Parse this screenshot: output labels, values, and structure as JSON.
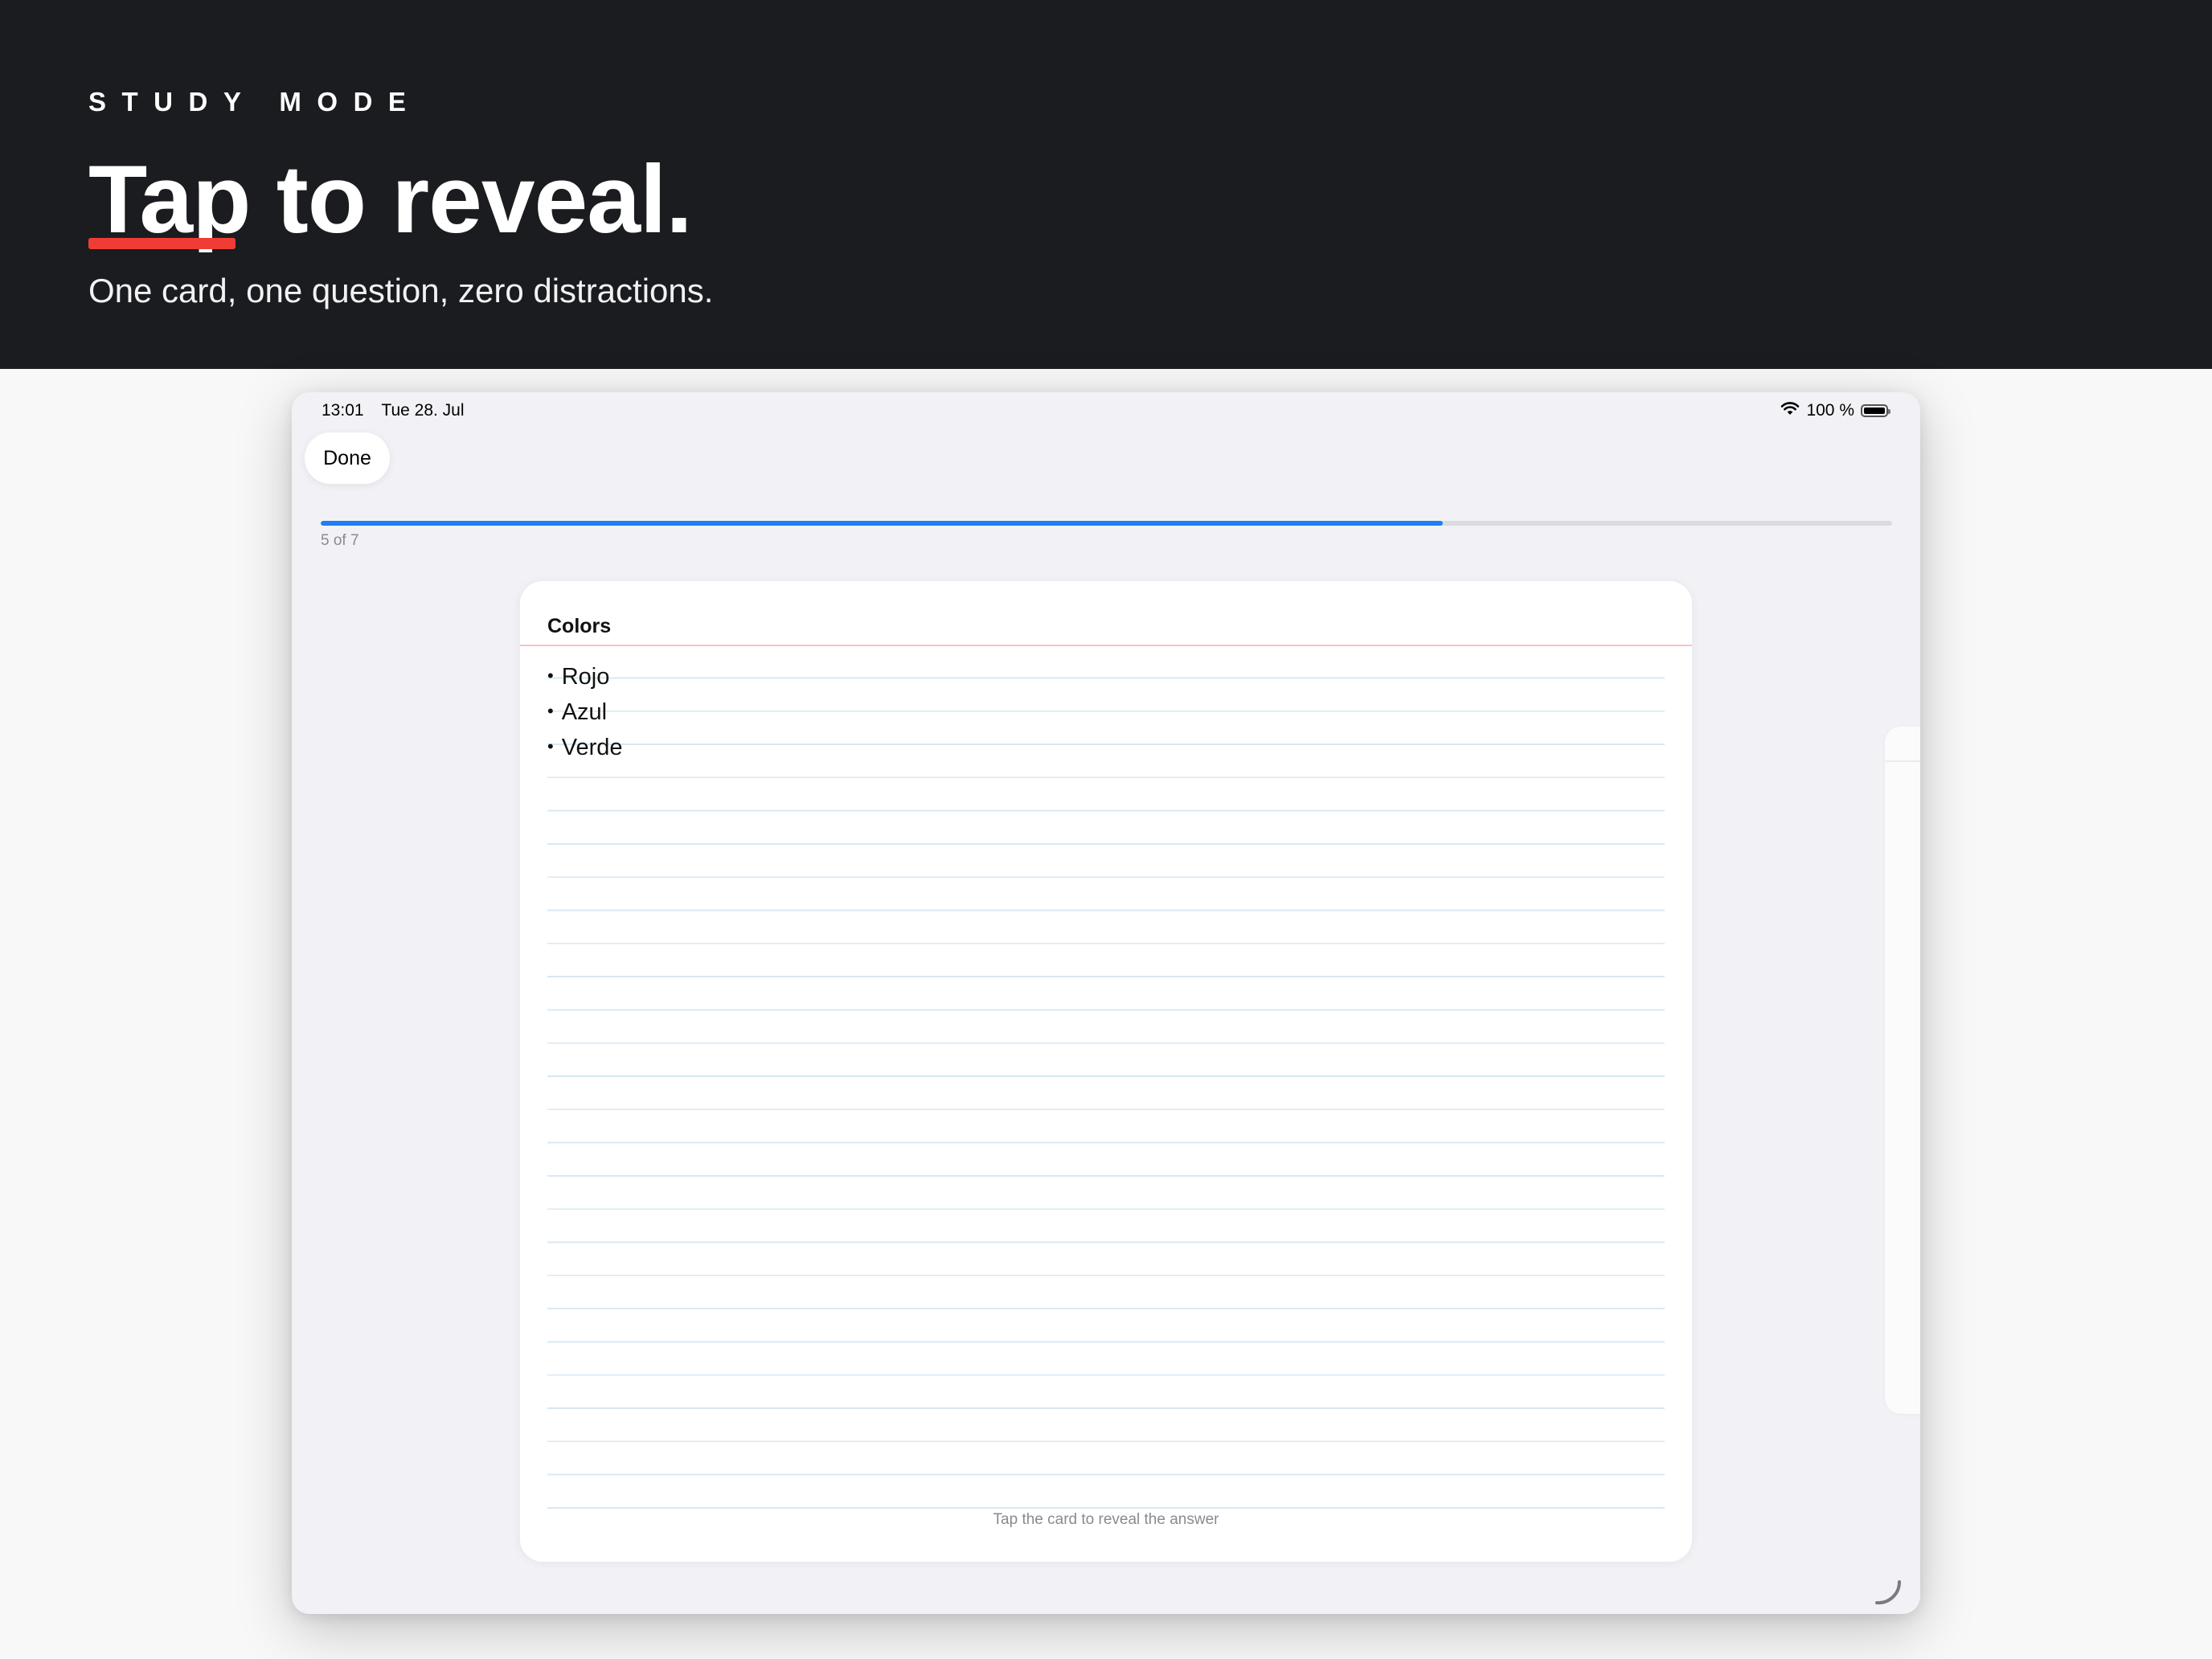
{
  "hero": {
    "eyebrow": "STUDY MODE",
    "headline_emphasis": "Tap",
    "headline_rest": " to reveal.",
    "subline": "One card, one question, zero distractions.",
    "accent_color": "#ef3d35"
  },
  "status_bar": {
    "time": "13:01",
    "date": "Tue 28. Jul",
    "battery": "100 %",
    "icons": [
      "wifi-icon",
      "battery-icon"
    ]
  },
  "toolbar": {
    "done_label": "Done"
  },
  "progress": {
    "current": 5,
    "total": 7,
    "fraction": 0.714,
    "label": "5 of 7",
    "color": "#1d7ff2"
  },
  "card": {
    "title": "Colors",
    "items": [
      "Rojo",
      "Azul",
      "Verde"
    ],
    "hint": "Tap the card to reveal the answer"
  }
}
